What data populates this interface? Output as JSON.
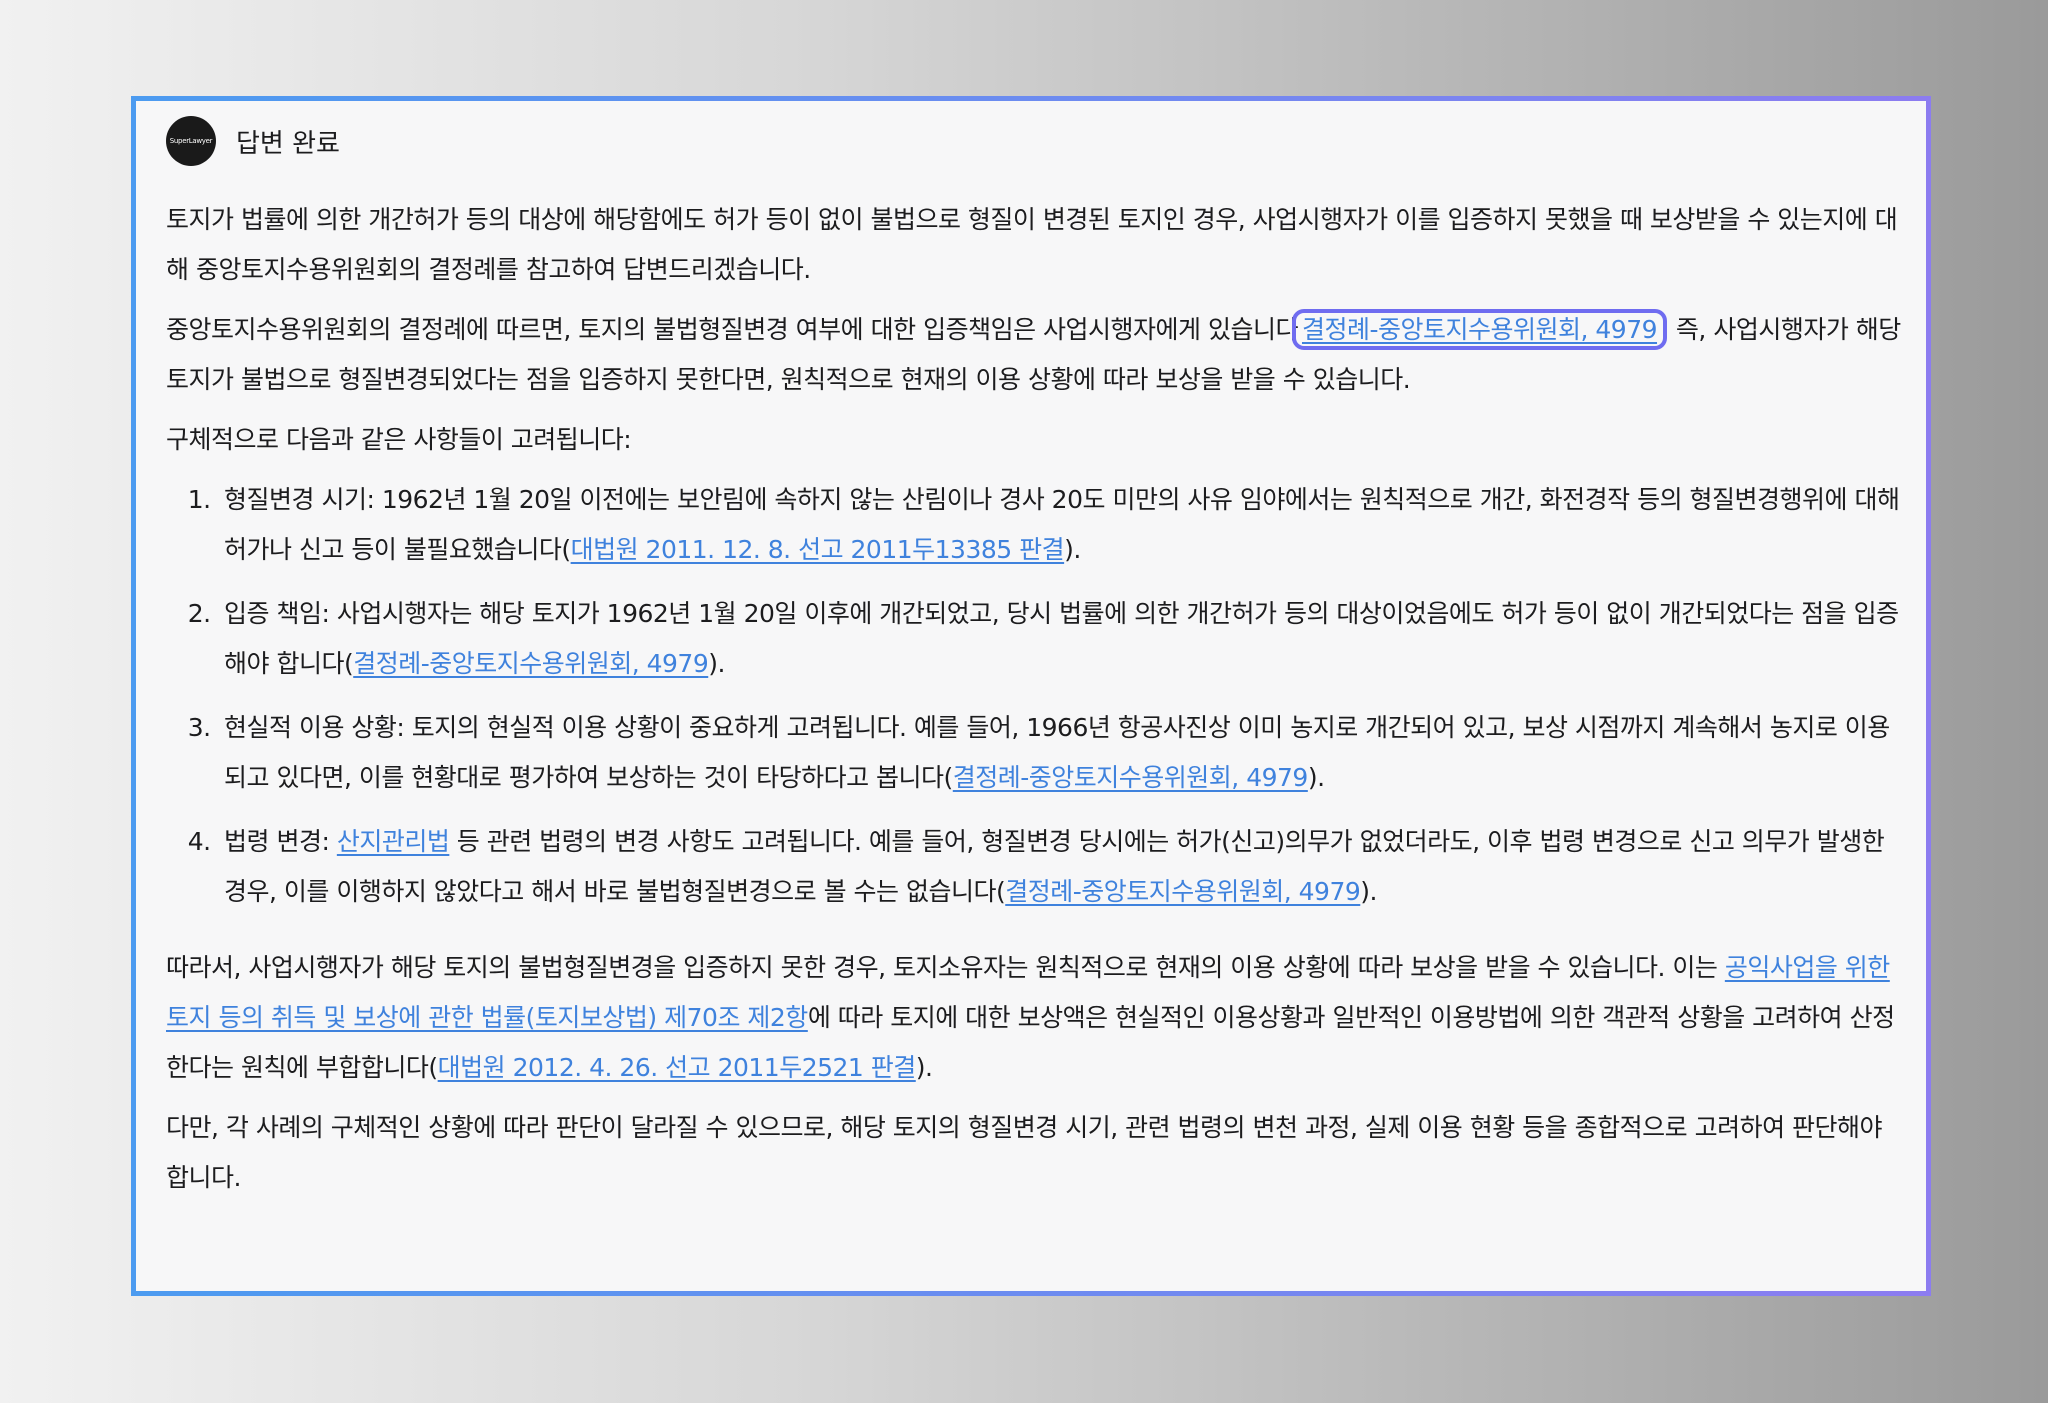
{
  "header": {
    "avatar_text": "SuperLawyer",
    "status": "답변 완료"
  },
  "intro": "토지가 법률에 의한 개간허가 등의 대상에 해당함에도 허가 등이 없이 불법으로 형질이 변경된 토지인 경우, 사업시행자가 이를 입증하지 못했을 때 보상받을 수 있는지에 대해 중앙토지수용위원회의 결정례를 참고하여 답변드리겠습니다.",
  "para2": {
    "before": "중앙토지수용위원회의 결정례에 따르면, 토지의 불법형질변경 여부에 대한 입증책임은 사업시행자에게 있습니다",
    "link": "결정례-중앙토지수용위원회, 4979",
    "after": ". 즉, 사업시행자가 해당 토지가 불법으로 형질변경되었다는 점을 입증하지 못한다면, 원칙적으로 현재의 이용 상황에 따라 보상을 받을 수 있습니다."
  },
  "considerations_intro": "구체적으로 다음과 같은 사항들이 고려됩니다:",
  "items": [
    {
      "before": "형질변경 시기: 1962년 1월 20일 이전에는 보안림에 속하지 않는 산림이나 경사 20도 미만의 사유 임야에서는 원칙적으로 개간, 화전경작 등의 형질변경행위에 대해 허가나 신고 등이 불필요했습니다(",
      "link": "대법원 2011. 12. 8. 선고 2011두13385 판결",
      "after": ")."
    },
    {
      "before": "입증 책임: 사업시행자는 해당 토지가 1962년 1월 20일 이후에 개간되었고, 당시 법률에 의한 개간허가 등의 대상이었음에도 허가 등이 없이 개간되었다는 점을 입증해야 합니다(",
      "link": "결정례-중앙토지수용위원회, 4979",
      "after": ")."
    },
    {
      "before": "현실적 이용 상황: 토지의 현실적 이용 상황이 중요하게 고려됩니다. 예를 들어, 1966년 항공사진상 이미 농지로 개간되어 있고, 보상 시점까지 계속해서 농지로 이용되고 있다면, 이를 현황대로 평가하여 보상하는 것이 타당하다고 봅니다(",
      "link": "결정례-중앙토지수용위원회, 4979",
      "after": ")."
    },
    {
      "pre": "법령 변경: ",
      "law_link": "산지관리법",
      "before": " 등 관련 법령의 변경 사항도 고려됩니다. 예를 들어, 형질변경 당시에는 허가(신고)의무가 없었더라도, 이후 법령 변경으로 신고 의무가 발생한 경우, 이를 이행하지 않았다고 해서 바로 불법형질변경으로 볼 수는 없습니다(",
      "link": "결정례-중앙토지수용위원회, 4979",
      "after": ")."
    }
  ],
  "conclusion": {
    "before": "따라서, 사업시행자가 해당 토지의 불법형질변경을 입증하지 못한 경우, 토지소유자는 원칙적으로 현재의 이용 상황에 따라 보상을 받을 수 있습니다. 이는 ",
    "law_link": "공익사업을 위한 토지 등의 취득 및 보상에 관한 법률(토지보상법) 제70조 제2항",
    "middle": "에 따라 토지에 대한 보상액은 현실적인 이용상황과 일반적인 이용방법에 의한 객관적 상황을 고려하여 산정한다는 원칙에 부합합니다(",
    "link": "대법원 2012. 4. 26. 선고 2011두2521 판결",
    "after": ")."
  },
  "final": "다만, 각 사례의 구체적인 상황에 따라 판단이 달라질 수 있으므로, 해당 토지의 형질변경 시기, 관련 법령의 변천 과정, 실제 이용 현황 등을 종합적으로 고려하여 판단해야 합니다."
}
